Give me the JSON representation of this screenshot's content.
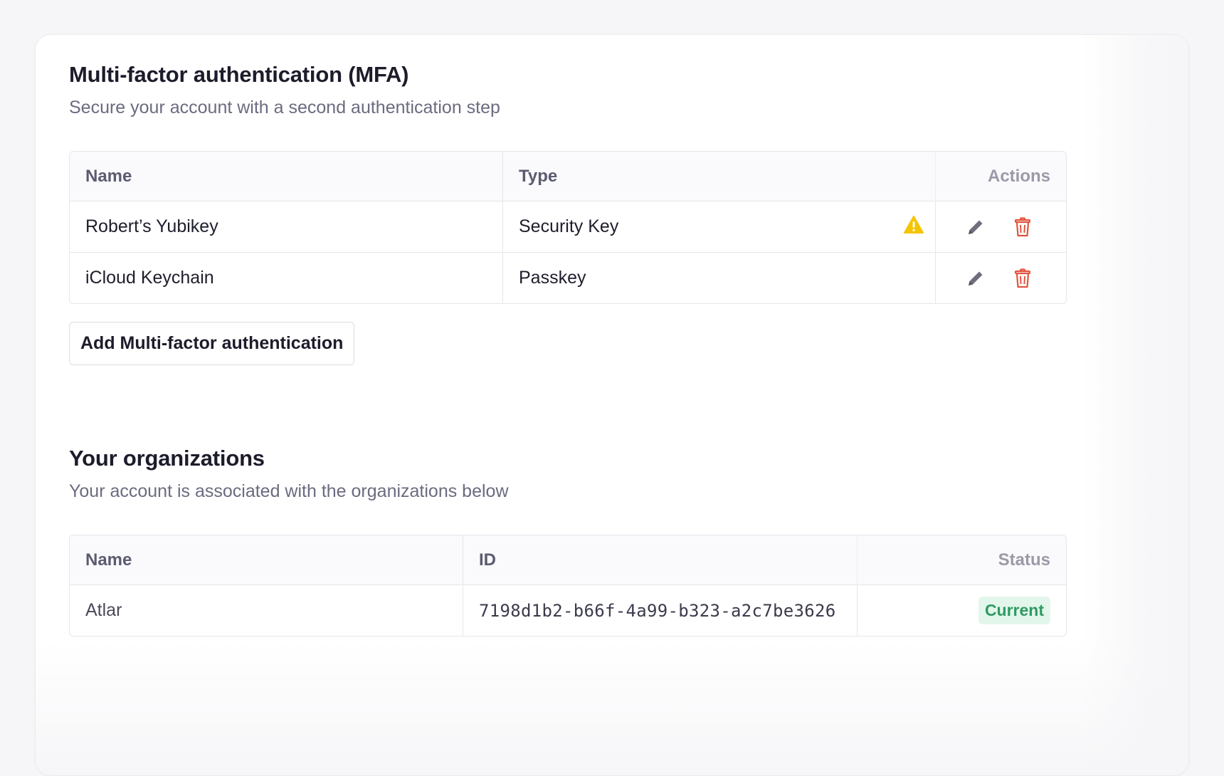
{
  "mfa": {
    "title": "Multi-factor authentication (MFA)",
    "subtitle": "Secure your account with a second authentication step",
    "columns": {
      "name": "Name",
      "type": "Type",
      "actions": "Actions"
    },
    "rows": [
      {
        "name": "Robert’s Yubikey",
        "type": "Security Key",
        "warning_icon": "warning-triangle-icon",
        "edit_icon": "pencil-icon",
        "delete_icon": "trash-icon"
      },
      {
        "name": "iCloud Keychain",
        "type": "Passkey",
        "edit_icon": "pencil-icon",
        "delete_icon": "trash-icon"
      }
    ],
    "add_button_label": "Add Multi-factor authentication"
  },
  "organizations": {
    "title": "Your organizations",
    "subtitle": "Your account is associated with the organizations below",
    "columns": {
      "name": "Name",
      "id": "ID",
      "status": "Status"
    },
    "rows": [
      {
        "name": "Atlar",
        "id": "7198d1b2-b66f-4a99-b323-a2c7be3626",
        "status": "Current"
      }
    ]
  },
  "colors": {
    "warning": "#f5c400",
    "delete": "#e2553f",
    "edit": "#6e6e7c",
    "status_current_bg": "#e3f6ec",
    "status_current_text": "#2f9a62"
  }
}
